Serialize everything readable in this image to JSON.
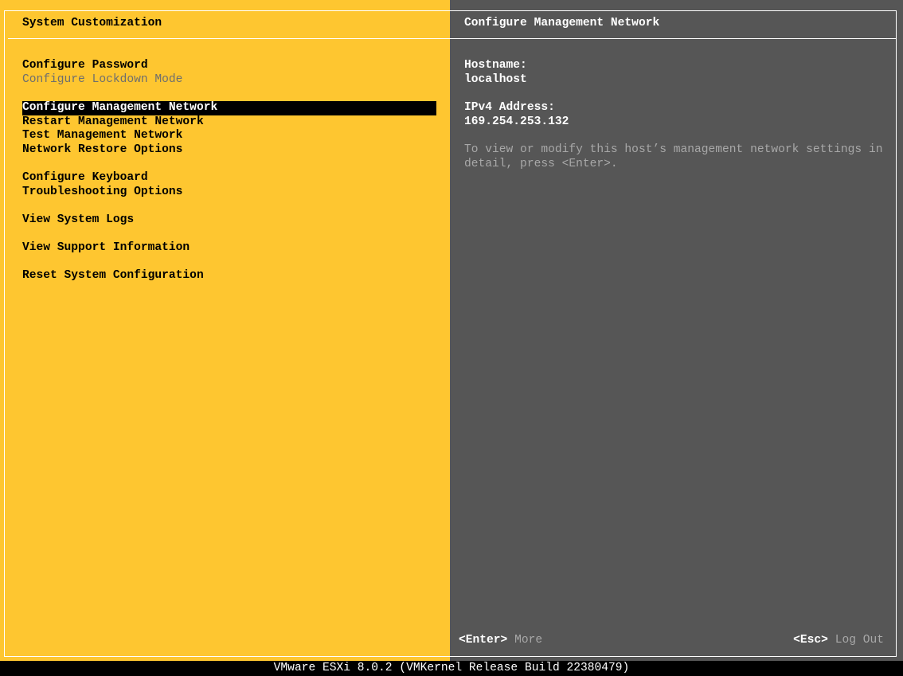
{
  "left_panel": {
    "title": "System Customization",
    "items": [
      {
        "label": "Configure Password",
        "state": "enabled"
      },
      {
        "label": "Configure Lockdown Mode",
        "state": "disabled"
      },
      {
        "label": "Configure Management Network",
        "state": "selected"
      },
      {
        "label": "Restart Management Network",
        "state": "enabled"
      },
      {
        "label": "Test Management Network",
        "state": "enabled"
      },
      {
        "label": "Network Restore Options",
        "state": "enabled"
      },
      {
        "label": "Configure Keyboard",
        "state": "enabled"
      },
      {
        "label": "Troubleshooting Options",
        "state": "enabled"
      },
      {
        "label": "View System Logs",
        "state": "enabled"
      },
      {
        "label": "View Support Information",
        "state": "enabled"
      },
      {
        "label": "Reset System Configuration",
        "state": "enabled"
      }
    ]
  },
  "right_panel": {
    "title": "Configure Management Network",
    "hostname_label": "Hostname:",
    "hostname_value": "localhost",
    "ipv4_label": "IPv4 Address:",
    "ipv4_value": "169.254.253.132",
    "help_line1": "To view or modify this host’s management network settings in",
    "help_line2": "detail, press <Enter>."
  },
  "keys": {
    "enter_key": "<Enter>",
    "enter_action": "More",
    "esc_key": "<Esc>",
    "esc_action": "Log Out"
  },
  "footer": "VMware ESXi 8.0.2 (VMKernel Release Build 22380479)",
  "colors": {
    "accent": "#fec630",
    "panel": "#565656"
  }
}
